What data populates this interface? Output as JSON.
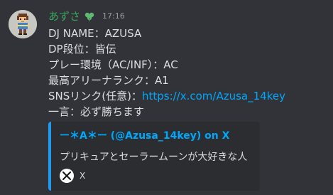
{
  "message": {
    "author": "あずさ",
    "timestamp": "17:16",
    "lines": [
      "DJ NAME：AZUSA",
      "DP段位：皆伝",
      "プレー環境（AC/INF）：AC",
      "最高アリーナランク：A1"
    ],
    "sns_label": "SNSリンク(任意)：",
    "sns_link": "https://x.com/Azusa_14key",
    "last_line": "一言：必ず勝ちます"
  },
  "embed": {
    "author": "ー＊A＊ー (@Azusa_14key) on X",
    "description": "プリキュアとセーラームーンが大好きな人",
    "footer": "X"
  },
  "colors": {
    "background": "#313338",
    "username": "#3ba55c",
    "link": "#00a8fc",
    "embed_background": "#2b2d31",
    "embed_border": "#1d9bf0",
    "timestamp": "#949ba4"
  },
  "icons": {
    "avatar": "pixel-character-avatar",
    "role": "clover-role-icon",
    "footer": "x-logo-icon"
  }
}
